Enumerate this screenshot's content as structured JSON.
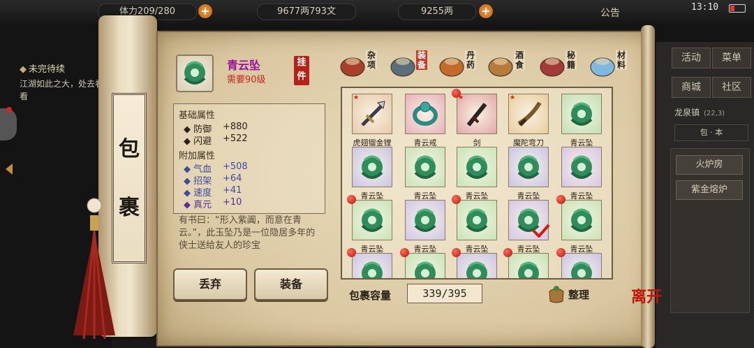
{
  "hud": {
    "stamina": "体力209/280",
    "copper": "9677两793文",
    "silver": "9255两",
    "plus": "+",
    "notice": "公告",
    "clock": "13:10"
  },
  "quest": {
    "title": "未完待续",
    "desc": "江湖如此之大，处去看看"
  },
  "right_menu": {
    "buttons": [
      "活动",
      "菜单",
      "商城",
      "社区"
    ],
    "location": "龙泉镇",
    "coords": "(22,3)",
    "row": "包 · 本",
    "items": [
      "火炉房",
      "紫金熔炉"
    ]
  },
  "bag_title": [
    "包",
    "裹"
  ],
  "item": {
    "name": "青云坠",
    "level": "需要90级",
    "type_stamp": "挂件",
    "base_title": "基础属性",
    "base_attrs": [
      {
        "name": "防御",
        "value": "+880"
      },
      {
        "name": "闪避",
        "value": "+522"
      }
    ],
    "extra_title": "附加属性",
    "extra_attrs": [
      {
        "name": "气血",
        "value": "+508"
      },
      {
        "name": "招架",
        "value": "+64"
      },
      {
        "name": "速度",
        "value": "+41"
      },
      {
        "name": "真元",
        "value": "+10"
      }
    ],
    "desc": "有书曰：“形入紫阗，而意在青云。”，此玉坠乃是一位隐居多年的侠士送给友人的珍宝"
  },
  "buttons": {
    "discard": "丢弃",
    "equip": "装备"
  },
  "categories": [
    {
      "label": "杂项",
      "active": false
    },
    {
      "label": "装备",
      "active": true
    },
    {
      "label": "丹药",
      "active": false
    },
    {
      "label": "酒食",
      "active": false
    },
    {
      "label": "秘籍",
      "active": false
    },
    {
      "label": "材料",
      "active": false
    }
  ],
  "slots": [
    {
      "label": "虎翅镏金镗",
      "kind": "spear",
      "frame": "#e9c9a9",
      "dot": false,
      "star": true
    },
    {
      "label": "青云戒",
      "kind": "ring",
      "frame": "#e7b0b8",
      "dot": false,
      "star": false
    },
    {
      "label": "剑",
      "kind": "sword",
      "frame": "#e3a6a6",
      "dot": true,
      "star": true
    },
    {
      "label": "魔陀弯刀",
      "kind": "blade",
      "frame": "#e9cc9a",
      "dot": false,
      "star": true
    },
    {
      "label": "青云坠",
      "kind": "pendant",
      "frame": "#bfe0b4",
      "dot": false,
      "star": false
    },
    {
      "label": "青云坠",
      "kind": "pendant",
      "frame": "#c9c4e6",
      "dot": false,
      "star": false
    },
    {
      "label": "青云坠",
      "kind": "pendant",
      "frame": "#c9e2b8",
      "dot": false,
      "star": false
    },
    {
      "label": "青云坠",
      "kind": "pendant",
      "frame": "#c6e4b6",
      "dot": false,
      "star": false
    },
    {
      "label": "青云坠",
      "kind": "pendant",
      "frame": "#c9c4e6",
      "dot": false,
      "star": false
    },
    {
      "label": "青云坠",
      "kind": "pendant",
      "frame": "#d7c4e6",
      "dot": false,
      "star": false
    },
    {
      "label": "青云坠",
      "kind": "pendant",
      "frame": "#c6e4b6",
      "dot": true,
      "star": false
    },
    {
      "label": "青云坠",
      "kind": "pendant",
      "frame": "#cfc6e8",
      "dot": false,
      "star": false
    },
    {
      "label": "青云坠",
      "kind": "pendant",
      "frame": "#c6e4b6",
      "dot": true,
      "star": false
    },
    {
      "label": "青云坠",
      "kind": "pendant",
      "frame": "#d5c4e8",
      "dot": false,
      "star": false,
      "check": true
    },
    {
      "label": "青云坠",
      "kind": "pendant",
      "frame": "#c6e4b6",
      "dot": true,
      "star": false
    },
    {
      "label": "",
      "kind": "pendant",
      "frame": "#c9c4e6",
      "dot": true,
      "star": false
    },
    {
      "label": "",
      "kind": "pendant",
      "frame": "#c6e4b6",
      "dot": true,
      "star": false
    },
    {
      "label": "",
      "kind": "pendant",
      "frame": "#c9c4e6",
      "dot": true,
      "star": false
    },
    {
      "label": "",
      "kind": "pendant",
      "frame": "#c6e4b6",
      "dot": true,
      "star": false
    },
    {
      "label": "",
      "kind": "pendant",
      "frame": "#c9c4e6",
      "dot": true,
      "star": false
    }
  ],
  "capacity": {
    "label": "包裹容量",
    "value": "339/395"
  },
  "sort_label": "整理",
  "leave_label": "离开"
}
